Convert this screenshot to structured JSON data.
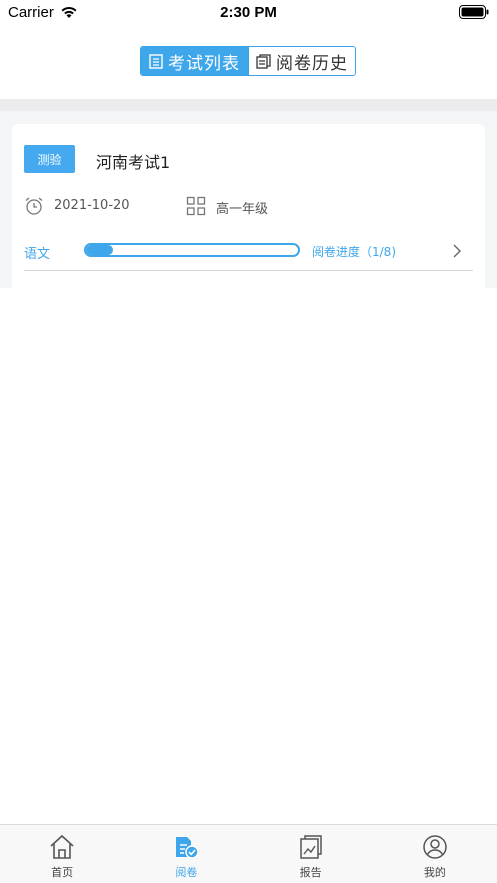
{
  "status_bar": {
    "carrier": "Carrier",
    "time": "2:30 PM"
  },
  "header": {
    "tabs": [
      {
        "label": "考试列表",
        "active": true,
        "icon": "list-icon"
      },
      {
        "label": "阅卷历史",
        "active": false,
        "icon": "history-doc-icon"
      }
    ]
  },
  "exam_card": {
    "badge": "测验",
    "title": "河南考试1",
    "date": "2021-10-20",
    "grade": "高一年级",
    "subject": "语文",
    "progress_text": "阅卷进度（1/8)",
    "progress_fraction": 0.125
  },
  "tab_bar": {
    "items": [
      {
        "label": "首页",
        "icon": "home-icon",
        "active": false
      },
      {
        "label": "阅卷",
        "icon": "grading-icon",
        "active": true
      },
      {
        "label": "报告",
        "icon": "report-icon",
        "active": false
      },
      {
        "label": "我的",
        "icon": "profile-icon",
        "active": false
      }
    ]
  },
  "colors": {
    "accent": "#3ea6ea",
    "background": "#f4f5f7"
  }
}
